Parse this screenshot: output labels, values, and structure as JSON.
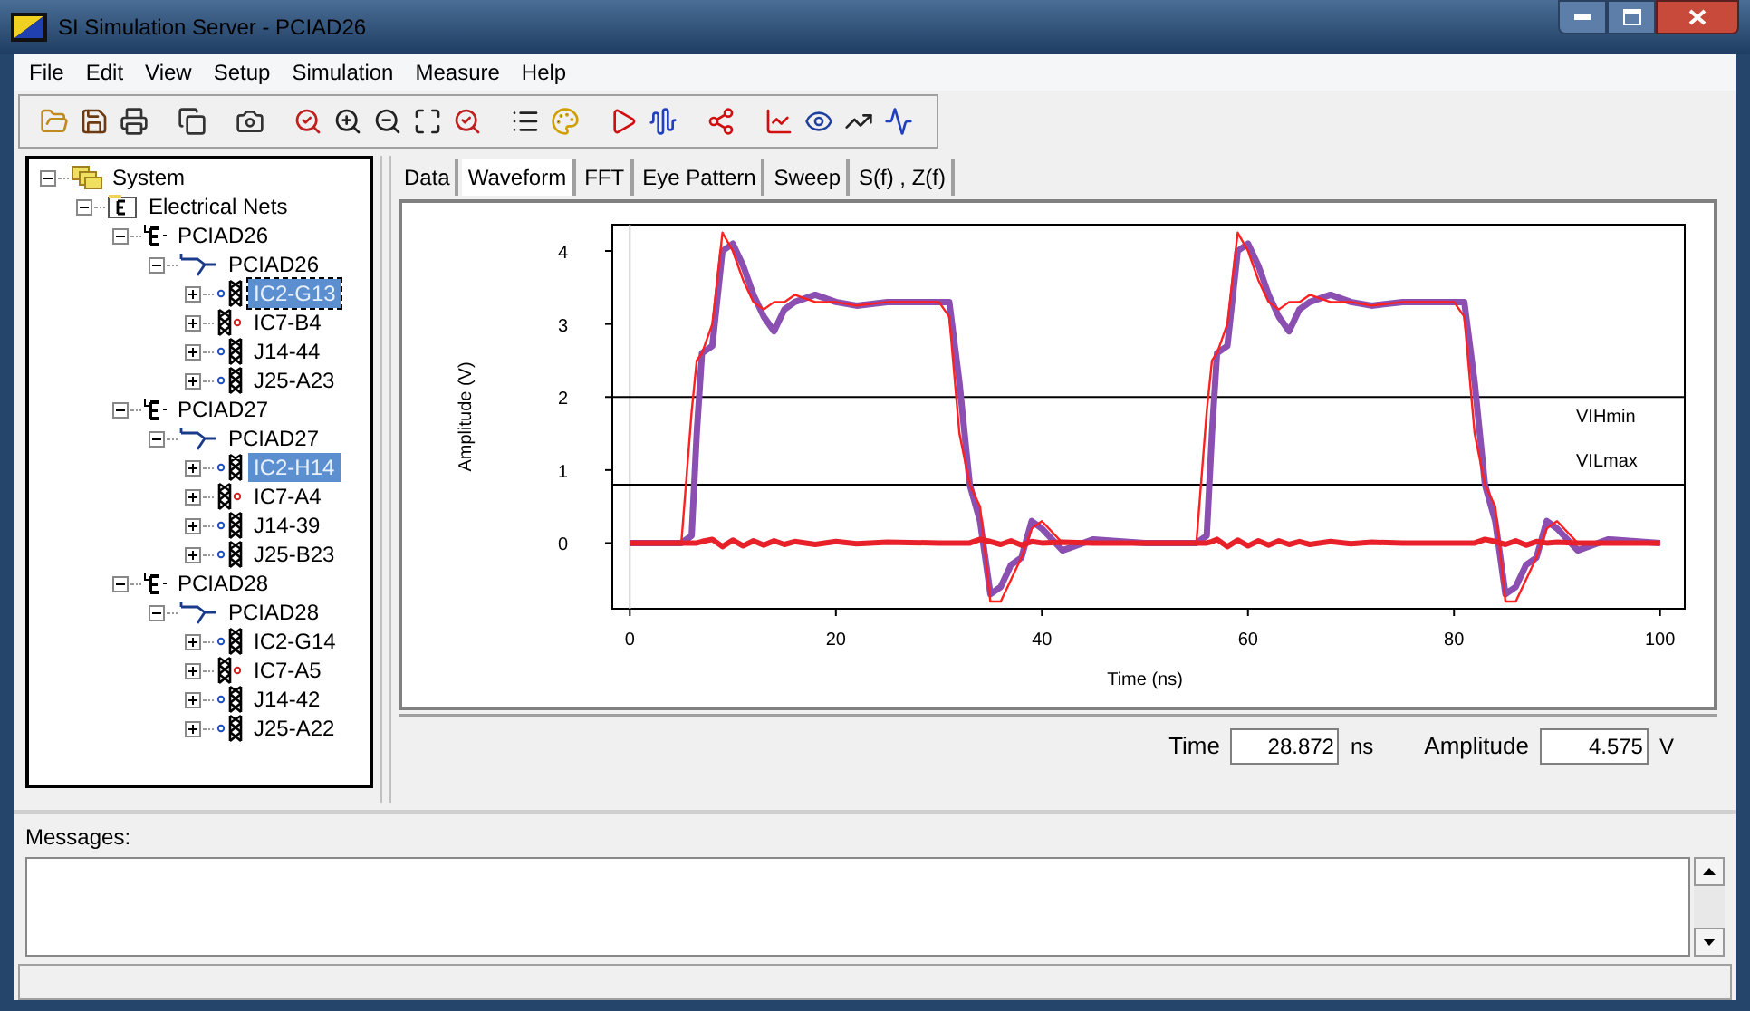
{
  "window": {
    "title": "SI Simulation Server - PCIAD26"
  },
  "menu": [
    "File",
    "Edit",
    "View",
    "Setup",
    "Simulation",
    "Measure",
    "Help"
  ],
  "tree": [
    {
      "label": "System",
      "kind": "system",
      "expanded": true,
      "selected": false,
      "focused": false,
      "children": [
        {
          "label": "Electrical Nets",
          "kind": "nets",
          "expanded": true,
          "selected": false,
          "focused": false,
          "children": [
            {
              "label": "PCIAD26",
              "kind": "net",
              "expanded": true,
              "selected": false,
              "focused": false,
              "children": [
                {
                  "label": "PCIAD26",
                  "kind": "bus",
                  "expanded": true,
                  "selected": false,
                  "focused": false,
                  "children": [
                    {
                      "label": "IC2-G13",
                      "kind": "receiver",
                      "expanded": false,
                      "selected": true,
                      "focused": true
                    },
                    {
                      "label": "IC7-B4",
                      "kind": "driver",
                      "expanded": false,
                      "selected": false,
                      "focused": false
                    },
                    {
                      "label": "J14-44",
                      "kind": "receiver",
                      "expanded": false,
                      "selected": false,
                      "focused": false
                    },
                    {
                      "label": "J25-A23",
                      "kind": "receiver",
                      "expanded": false,
                      "selected": false,
                      "focused": false
                    }
                  ]
                }
              ]
            },
            {
              "label": "PCIAD27",
              "kind": "net",
              "expanded": true,
              "selected": false,
              "focused": false,
              "children": [
                {
                  "label": "PCIAD27",
                  "kind": "bus",
                  "expanded": true,
                  "selected": false,
                  "focused": false,
                  "children": [
                    {
                      "label": "IC2-H14",
                      "kind": "receiver",
                      "expanded": false,
                      "selected": true,
                      "focused": false
                    },
                    {
                      "label": "IC7-A4",
                      "kind": "driver",
                      "expanded": false,
                      "selected": false,
                      "focused": false
                    },
                    {
                      "label": "J14-39",
                      "kind": "receiver",
                      "expanded": false,
                      "selected": false,
                      "focused": false
                    },
                    {
                      "label": "J25-B23",
                      "kind": "receiver",
                      "expanded": false,
                      "selected": false,
                      "focused": false
                    }
                  ]
                }
              ]
            },
            {
              "label": "PCIAD28",
              "kind": "net",
              "expanded": true,
              "selected": false,
              "focused": false,
              "children": [
                {
                  "label": "PCIAD28",
                  "kind": "bus",
                  "expanded": true,
                  "selected": false,
                  "focused": false,
                  "children": [
                    {
                      "label": "IC2-G14",
                      "kind": "receiver",
                      "expanded": false,
                      "selected": false,
                      "focused": false
                    },
                    {
                      "label": "IC7-A5",
                      "kind": "driver",
                      "expanded": false,
                      "selected": false,
                      "focused": false
                    },
                    {
                      "label": "J14-42",
                      "kind": "receiver",
                      "expanded": false,
                      "selected": false,
                      "focused": false
                    },
                    {
                      "label": "J25-A22",
                      "kind": "receiver",
                      "expanded": false,
                      "selected": false,
                      "focused": false
                    }
                  ]
                }
              ]
            }
          ]
        }
      ]
    }
  ],
  "tabs": [
    {
      "label": "Data",
      "selected": false
    },
    {
      "label": "Waveform",
      "selected": true
    },
    {
      "label": "FFT",
      "selected": false
    },
    {
      "label": "Eye Pattern",
      "selected": false
    },
    {
      "label": "Sweep",
      "selected": false
    },
    {
      "label": "S(f) , Z(f)",
      "selected": false
    }
  ],
  "chart_data": {
    "type": "line",
    "xlabel": "Time (ns)",
    "ylabel": "Amplitude (V)",
    "xlim": [
      -1.7,
      102.4
    ],
    "ylim": [
      -0.9,
      4.36
    ],
    "xticks": [
      0,
      20,
      40,
      60,
      80,
      100
    ],
    "yticks": [
      0,
      1,
      2,
      3,
      4
    ],
    "x": [
      0,
      5,
      6,
      6.5,
      7,
      8,
      9,
      10,
      11,
      12,
      13,
      14,
      15,
      16,
      18,
      20,
      22,
      25,
      30,
      31,
      32,
      33,
      34,
      35,
      36,
      37,
      38,
      39,
      40,
      42,
      45,
      50,
      55,
      56,
      56.5,
      57,
      58,
      59,
      60,
      61,
      62,
      63,
      64,
      65,
      66,
      68,
      70,
      72,
      75,
      80,
      81,
      82,
      83,
      84,
      85,
      86,
      87,
      88,
      89,
      90,
      92,
      95,
      100
    ],
    "series": [
      {
        "color": "#8a4fb0",
        "values": [
          0,
          0,
          0.1,
          1.5,
          2.6,
          2.7,
          4.0,
          4.1,
          3.8,
          3.4,
          3.1,
          2.9,
          3.2,
          3.3,
          3.4,
          3.3,
          3.25,
          3.3,
          3.3,
          3.3,
          2.2,
          0.8,
          0.3,
          -0.7,
          -0.6,
          -0.3,
          -0.2,
          0.3,
          0.2,
          -0.1,
          0.05,
          0,
          0,
          0.1,
          1.5,
          2.6,
          2.7,
          4.0,
          4.1,
          3.8,
          3.4,
          3.1,
          2.9,
          3.2,
          3.3,
          3.4,
          3.3,
          3.25,
          3.3,
          3.3,
          3.3,
          2.2,
          0.8,
          0.3,
          -0.7,
          -0.6,
          -0.3,
          -0.2,
          0.3,
          0.2,
          -0.1,
          0.05,
          0
        ]
      },
      {
        "color": "#ff2020",
        "values": [
          0,
          0,
          1.8,
          2.5,
          2.6,
          3.0,
          4.25,
          4.0,
          3.6,
          3.3,
          3.2,
          3.3,
          3.3,
          3.4,
          3.3,
          3.3,
          3.25,
          3.3,
          3.3,
          3.1,
          1.5,
          0.8,
          0.5,
          -0.8,
          -0.8,
          -0.5,
          -0.2,
          0.2,
          0.3,
          0.0,
          0,
          0,
          0,
          1.8,
          2.5,
          2.6,
          3.0,
          4.25,
          4.0,
          3.6,
          3.3,
          3.2,
          3.3,
          3.3,
          3.4,
          3.3,
          3.3,
          3.25,
          3.3,
          3.3,
          3.1,
          1.5,
          0.8,
          0.5,
          -0.8,
          -0.8,
          -0.5,
          -0.2,
          0.2,
          0.3,
          0.0,
          0,
          0
        ]
      },
      {
        "color": "#e8202a",
        "values": [
          0,
          0,
          0,
          0,
          0.02,
          0.05,
          -0.05,
          0.04,
          -0.04,
          0.03,
          -0.03,
          0.03,
          -0.02,
          0.02,
          -0.02,
          0.02,
          -0.01,
          0.01,
          0,
          0,
          0,
          0,
          0.05,
          0.02,
          -0.02,
          0.03,
          -0.03,
          0.02,
          0,
          0.01,
          0,
          0,
          0,
          0,
          0.02,
          0.05,
          -0.05,
          0.04,
          -0.04,
          0.03,
          -0.03,
          0.03,
          -0.02,
          0.02,
          -0.02,
          0.02,
          -0.01,
          0.01,
          0,
          0,
          0,
          0,
          0.05,
          0.02,
          -0.02,
          0.03,
          -0.03,
          0.02,
          0,
          0.01,
          0,
          0,
          0
        ]
      }
    ],
    "ref_lines": [
      {
        "axis": "y",
        "value": 2,
        "label": "VIHmin"
      },
      {
        "axis": "y",
        "value": 0.8,
        "label": "VILmax"
      }
    ]
  },
  "readout": [
    {
      "label": "Time",
      "value": "28.872",
      "unit": "ns"
    },
    {
      "label": "Amplitude",
      "value": "4.575",
      "unit": "V"
    }
  ],
  "messages": {
    "label": "Messages:"
  }
}
